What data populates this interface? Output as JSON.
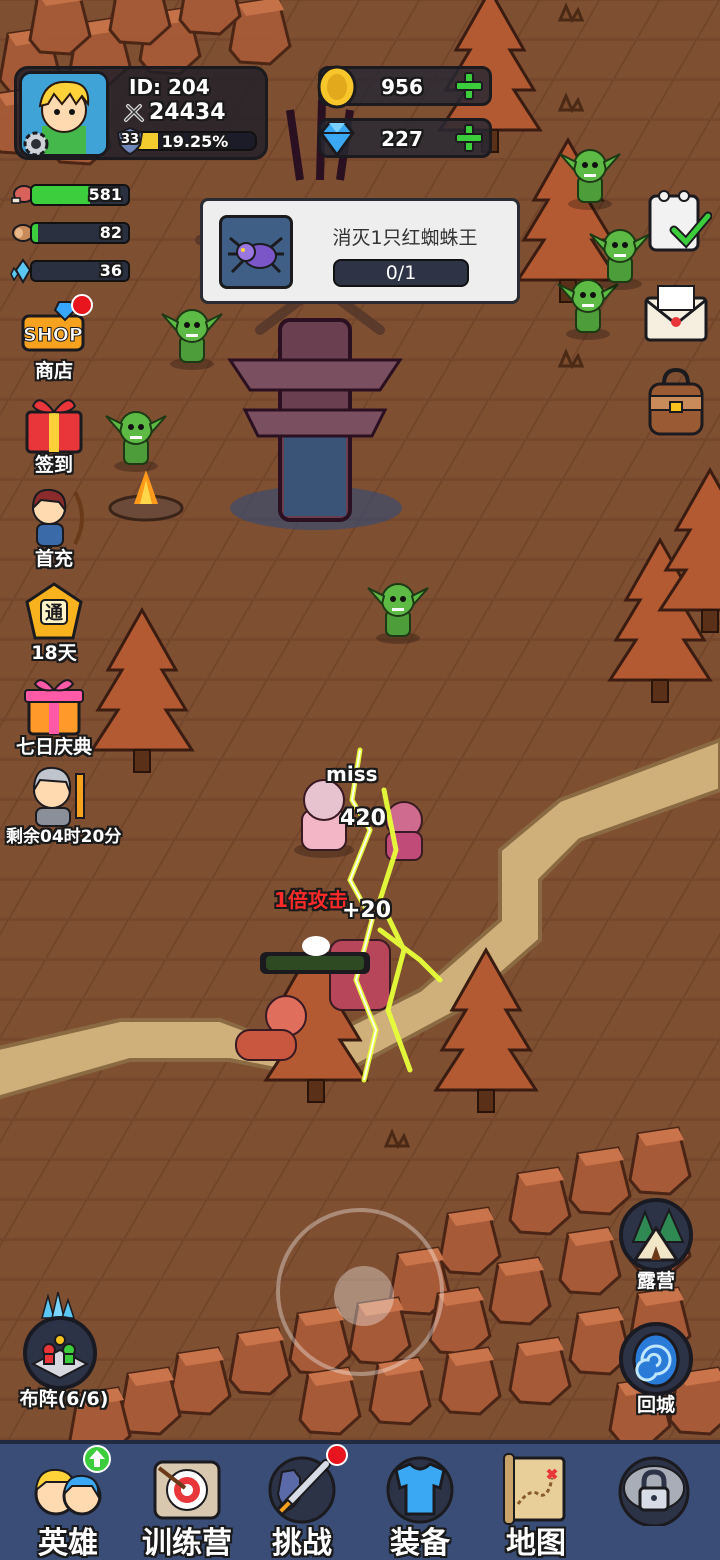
{
  "player": {
    "id_label": "ID: 204",
    "power": "24434",
    "level": "33",
    "exp_percent_label": "19.25%",
    "exp_fraction": 0.1925
  },
  "currency": {
    "gold": "956",
    "diamond": "227"
  },
  "resources": {
    "meat": "581",
    "wood": "82",
    "crystal": "36"
  },
  "quest": {
    "title": "消灭1只红蜘蛛王",
    "progress": "0/1"
  },
  "left_menu": {
    "shop_badge": "SHOP",
    "shop": "商店",
    "checkin": "签到",
    "first_recharge": "首充",
    "pass_badge": "通",
    "pass": "18天",
    "seven_day": "七日庆典",
    "timer": "剩余04时20分"
  },
  "battle": {
    "miss": "miss",
    "dmg1": "420",
    "dmg2": "+20",
    "crit": "1倍攻击"
  },
  "side_buttons": {
    "camp": "露营",
    "formation": "布阵(6/6)",
    "return_city": "回城"
  },
  "bottom_nav": {
    "heroes": "英雄",
    "training": "训练营",
    "challenge": "挑战",
    "equipment": "装备",
    "map": "地图"
  },
  "colors": {
    "hp_green": "#3cce3c",
    "exp_yellow": "#f3cc2e",
    "nav_bg": "#3a4d76",
    "badge_red": "#e8141e"
  },
  "icons": [
    "gear-icon",
    "sword-icon",
    "shield-icon",
    "gold-coin-icon",
    "diamond-icon",
    "plus-icon",
    "meat-icon",
    "wood-icon",
    "crystal-icon",
    "spider-icon",
    "notepad-check-icon",
    "mail-icon",
    "backpack-icon",
    "camp-icon",
    "portal-icon",
    "formation-icon",
    "lock-icon"
  ]
}
